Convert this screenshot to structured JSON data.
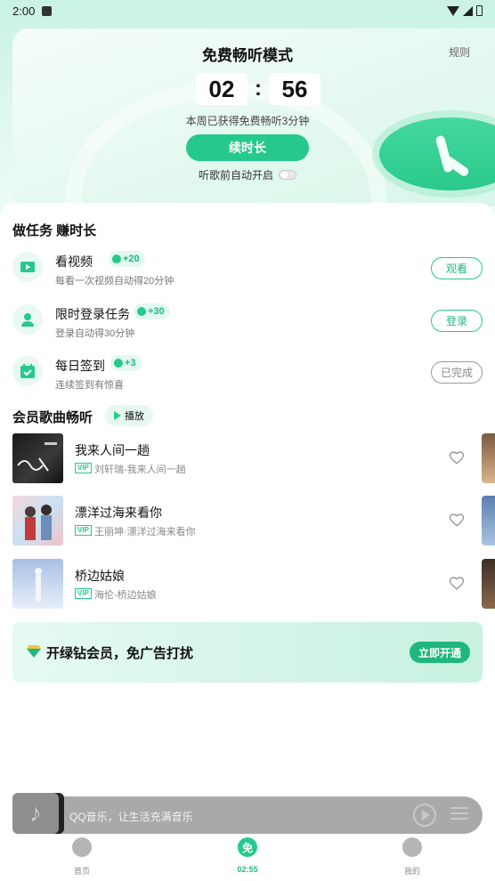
{
  "status_bar": {
    "time": "2:00"
  },
  "free_mode": {
    "title": "免费畅听模式",
    "rules": "规则",
    "minutes": "02",
    "seconds": "56",
    "separator": ":",
    "earned_text": "本周已获得免费畅听3分钟",
    "extend_button": "续时长",
    "autoplay_label": "听歌前自动开启"
  },
  "tasks_section": {
    "title": "做任务 赚时长",
    "tasks": [
      {
        "name": "看视频",
        "badge": "+20",
        "desc": "每看一次视频自动得20分钟",
        "button": "观看",
        "icon": "video-icon"
      },
      {
        "name": "限时登录任务",
        "badge": "+30",
        "desc": "登录自动得30分钟",
        "button": "登录",
        "icon": "user-icon"
      },
      {
        "name": "每日签到",
        "badge": "+3",
        "desc": "连续签到有惊喜",
        "button": "已完成",
        "icon": "calendar-check-icon"
      }
    ]
  },
  "songs_section": {
    "title": "会员歌曲畅听",
    "play_label": "播放",
    "vip_tag": "VIP",
    "songs": [
      {
        "title": "我来人间一趟",
        "sub": "刘轩瑞-我来人间一趟"
      },
      {
        "title": "漂洋过海来看你",
        "sub": "王丽坤·漂洋过海来看你"
      },
      {
        "title": "桥边姑娘",
        "sub": "海伦-桥边姑娘"
      }
    ]
  },
  "vip_banner": {
    "text": "开绿钻会员，免广告打扰",
    "button": "立即开通"
  },
  "mini_player": {
    "text": "QQ音乐，让生活充满音乐"
  },
  "nav": {
    "items": [
      {
        "label": "首页"
      },
      {
        "label": "02:55",
        "icon_text": "免"
      },
      {
        "label": "我的"
      }
    ]
  },
  "colors": {
    "accent": "#25c98e",
    "accent_dark": "#1fb77f"
  }
}
